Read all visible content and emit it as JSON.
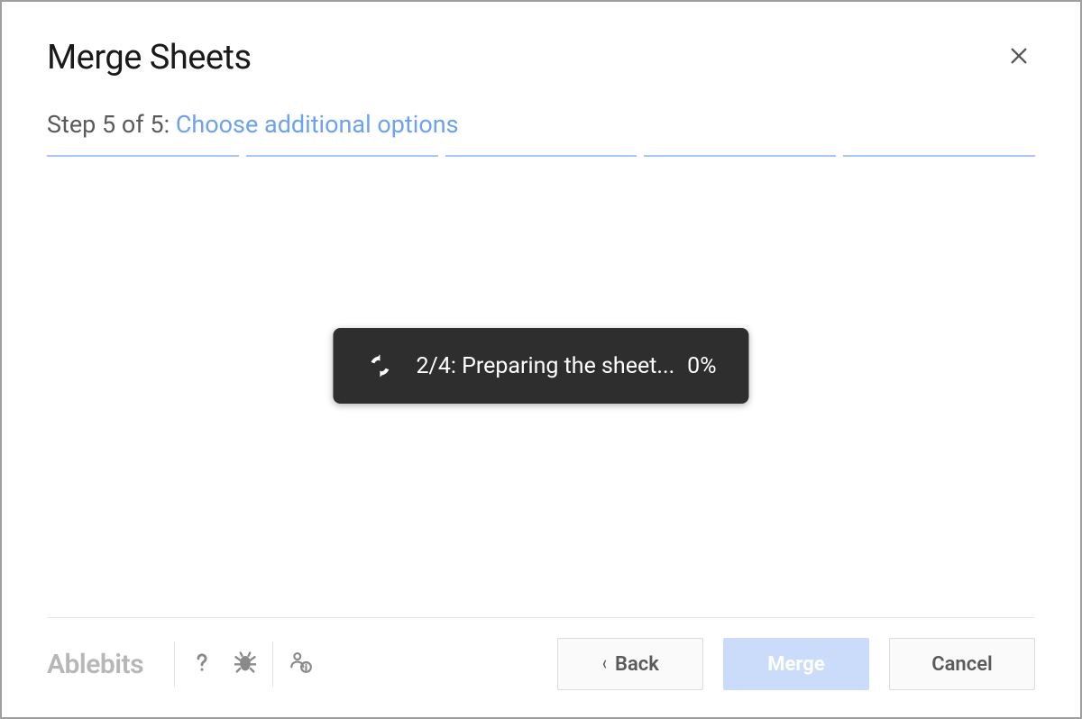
{
  "header": {
    "title": "Merge Sheets"
  },
  "step": {
    "prefix": "Step 5 of 5: ",
    "highlighted": "Choose additional options",
    "segments": 5
  },
  "toast": {
    "message": "2/4: Preparing the sheet...",
    "percent": "0%"
  },
  "footer": {
    "brand": "Ablebits",
    "buttons": {
      "back": "Back",
      "merge": "Merge",
      "cancel": "Cancel"
    }
  }
}
